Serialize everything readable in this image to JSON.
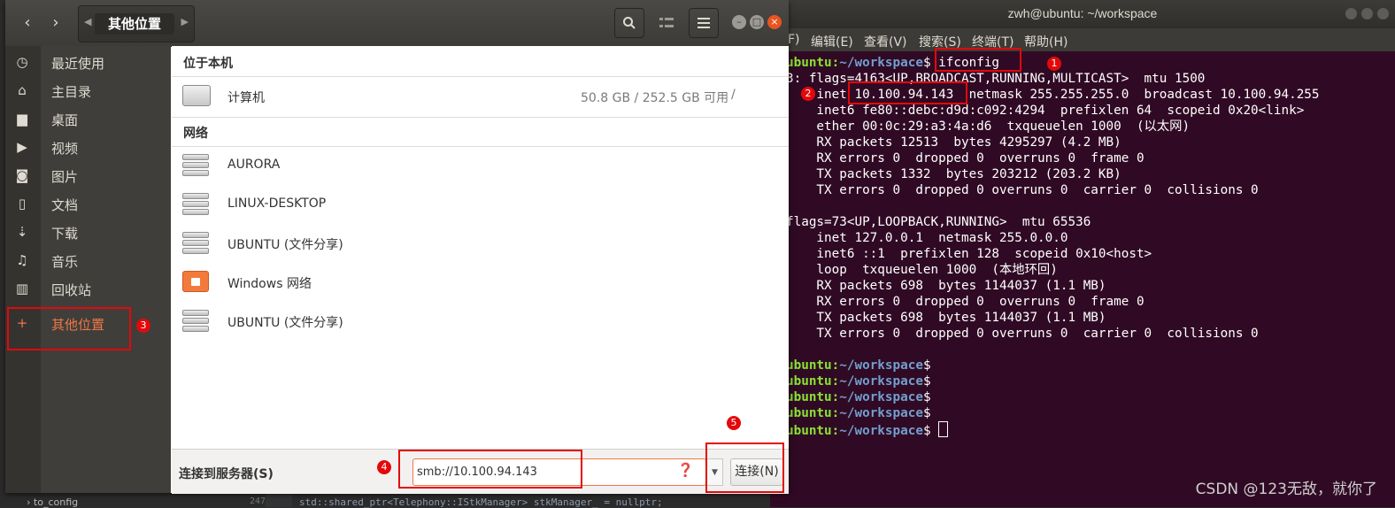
{
  "file_manager": {
    "location": "其他位置",
    "sidebar": [
      {
        "label": "最近使用",
        "icon": "clock-icon"
      },
      {
        "label": "主目录",
        "icon": "home-icon"
      },
      {
        "label": "桌面",
        "icon": "folder-icon"
      },
      {
        "label": "视频",
        "icon": "video-icon"
      },
      {
        "label": "图片",
        "icon": "camera-icon"
      },
      {
        "label": "文档",
        "icon": "document-icon"
      },
      {
        "label": "下载",
        "icon": "download-icon"
      },
      {
        "label": "音乐",
        "icon": "music-icon"
      },
      {
        "label": "回收站",
        "icon": "trash-icon"
      },
      {
        "label": "其他位置",
        "icon": "plus-icon",
        "active": true
      }
    ],
    "sections": {
      "local": "位于本机",
      "network": "网络"
    },
    "local_items": [
      {
        "label": "计算机",
        "size": "50.8 GB / 252.5 GB 可用",
        "mount": "/"
      }
    ],
    "network_items": [
      {
        "label": "AURORA",
        "icon": "server-icon"
      },
      {
        "label": "LINUX-DESKTOP",
        "icon": "server-icon"
      },
      {
        "label": "UBUNTU (文件分享)",
        "icon": "server-icon"
      },
      {
        "label": "Windows 网络",
        "icon": "network-folder-icon"
      },
      {
        "label": "UBUNTU (文件分享)",
        "icon": "server-icon"
      }
    ],
    "connect_label": "连接到服务器(S)",
    "server_address": "smb://10.100.94.143",
    "connect_button": "连接(N)"
  },
  "terminal": {
    "title": "zwh@ubuntu: ~/workspace",
    "menu": [
      "F)",
      "编辑(E)",
      "查看(V)",
      "搜索(S)",
      "终端(T)",
      "帮助(H)"
    ],
    "prompt_user": "ubuntu",
    "prompt_path": "~/workspace",
    "command": "ifconfig",
    "lines": [
      "3: flags=4163<UP,BROADCAST,RUNNING,MULTICAST>  mtu 1500",
      "    inet 10.100.94.143  netmask 255.255.255.0  broadcast 10.100.94.255",
      "    inet6 fe80::debc:d9d:c092:4294  prefixlen 64  scopeid 0x20<link>",
      "    ether 00:0c:29:a3:4a:d6  txqueuelen 1000  (以太网)",
      "    RX packets 12513  bytes 4295297 (4.2 MB)",
      "    RX errors 0  dropped 0  overruns 0  frame 0",
      "    TX packets 1332  bytes 203212 (203.2 KB)",
      "    TX errors 0  dropped 0 overruns 0  carrier 0  collisions 0",
      "",
      "flags=73<UP,LOOPBACK,RUNNING>  mtu 65536",
      "    inet 127.0.0.1  netmask 255.0.0.0",
      "    inet6 ::1  prefixlen 128  scopeid 0x10<host>",
      "    loop  txqueuelen 1000  (本地环回)",
      "    RX packets 698  bytes 1144037 (1.1 MB)",
      "    RX errors 0  dropped 0  overruns 0  frame 0",
      "    TX packets 698  bytes 1144037 (1.1 MB)",
      "    TX errors 0  dropped 0 overruns 0  carrier 0  collisions 0",
      ""
    ],
    "empty_prompts": 5
  },
  "annotations": [
    "1",
    "2",
    "3",
    "4",
    "5"
  ],
  "watermark": "CSDN @123无敌，就你了",
  "background_code": {
    "line_numbers": [
      "247",
      "246"
    ],
    "text1": "std::shared_ptr<Telephony::IStkManager> stkManager_ = nullptr;",
    "tree_item": "to_config"
  },
  "colors": {
    "accent": "#f07746",
    "annotation_red": "#e4080a",
    "terminal_bg": "#300a24",
    "prompt_green": "#8ae234",
    "prompt_blue": "#729fcf"
  }
}
